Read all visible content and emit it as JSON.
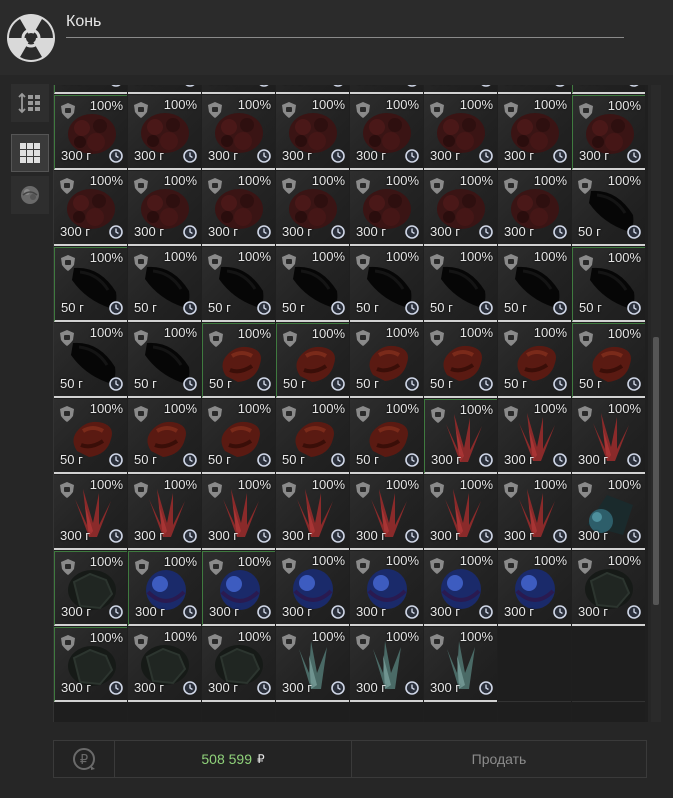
{
  "header": {
    "title": "Конь",
    "logo_icon": "radiation-icon"
  },
  "sidebar": {
    "buttons": [
      {
        "icon": "sort-icon"
      },
      {
        "icon": "grid-icon",
        "active": true
      },
      {
        "icon": "artifact-icon"
      }
    ]
  },
  "inventory": {
    "columns": 8,
    "partial_top_row_count": 8,
    "items": [
      {
        "type": "red-rock",
        "weight": "300 г",
        "durability": "100%",
        "green": true
      },
      {
        "type": "red-rock",
        "weight": "300 г",
        "durability": "100%",
        "green": false
      },
      {
        "type": "red-rock",
        "weight": "300 г",
        "durability": "100%",
        "green": false
      },
      {
        "type": "red-rock",
        "weight": "300 г",
        "durability": "100%",
        "green": false
      },
      {
        "type": "red-rock",
        "weight": "300 г",
        "durability": "100%",
        "green": false
      },
      {
        "type": "red-rock",
        "weight": "300 г",
        "durability": "100%",
        "green": false
      },
      {
        "type": "red-rock",
        "weight": "300 г",
        "durability": "100%",
        "green": false
      },
      {
        "type": "red-rock",
        "weight": "300 г",
        "durability": "100%",
        "green": true
      },
      {
        "type": "red-rock",
        "weight": "300 г",
        "durability": "100%",
        "green": false
      },
      {
        "type": "red-rock",
        "weight": "300 г",
        "durability": "100%",
        "green": false
      },
      {
        "type": "red-rock",
        "weight": "300 г",
        "durability": "100%",
        "green": false
      },
      {
        "type": "red-rock",
        "weight": "300 г",
        "durability": "100%",
        "green": false
      },
      {
        "type": "red-rock",
        "weight": "300 г",
        "durability": "100%",
        "green": false
      },
      {
        "type": "red-rock",
        "weight": "300 г",
        "durability": "100%",
        "green": false
      },
      {
        "type": "red-rock",
        "weight": "300 г",
        "durability": "100%",
        "green": false
      },
      {
        "type": "black-stone",
        "weight": "50 г",
        "durability": "100%",
        "green": false
      },
      {
        "type": "black-stone",
        "weight": "50 г",
        "durability": "100%",
        "green": true
      },
      {
        "type": "black-stone",
        "weight": "50 г",
        "durability": "100%",
        "green": false
      },
      {
        "type": "black-stone",
        "weight": "50 г",
        "durability": "100%",
        "green": false
      },
      {
        "type": "black-stone",
        "weight": "50 г",
        "durability": "100%",
        "green": false
      },
      {
        "type": "black-stone",
        "weight": "50 г",
        "durability": "100%",
        "green": false
      },
      {
        "type": "black-stone",
        "weight": "50 г",
        "durability": "100%",
        "green": false
      },
      {
        "type": "black-stone",
        "weight": "50 г",
        "durability": "100%",
        "green": false
      },
      {
        "type": "black-stone",
        "weight": "50 г",
        "durability": "100%",
        "green": true
      },
      {
        "type": "black-stone",
        "weight": "50 г",
        "durability": "100%",
        "green": false
      },
      {
        "type": "black-stone",
        "weight": "50 г",
        "durability": "100%",
        "green": false
      },
      {
        "type": "red-blob",
        "weight": "50 г",
        "durability": "100%",
        "green": true
      },
      {
        "type": "red-blob",
        "weight": "50 г",
        "durability": "100%",
        "green": true
      },
      {
        "type": "red-blob",
        "weight": "50 г",
        "durability": "100%",
        "green": false
      },
      {
        "type": "red-blob",
        "weight": "50 г",
        "durability": "100%",
        "green": false
      },
      {
        "type": "red-blob",
        "weight": "50 г",
        "durability": "100%",
        "green": false
      },
      {
        "type": "red-blob",
        "weight": "50 г",
        "durability": "100%",
        "green": true
      },
      {
        "type": "red-blob",
        "weight": "50 г",
        "durability": "100%",
        "green": false
      },
      {
        "type": "red-blob",
        "weight": "50 г",
        "durability": "100%",
        "green": false
      },
      {
        "type": "red-blob",
        "weight": "50 г",
        "durability": "100%",
        "green": false
      },
      {
        "type": "red-blob",
        "weight": "50 г",
        "durability": "100%",
        "green": false
      },
      {
        "type": "red-blob",
        "weight": "50 г",
        "durability": "100%",
        "green": false
      },
      {
        "type": "red-crystal",
        "weight": "300 г",
        "durability": "100%",
        "green": true
      },
      {
        "type": "red-crystal",
        "weight": "300 г",
        "durability": "100%",
        "green": false
      },
      {
        "type": "red-crystal",
        "weight": "300 г",
        "durability": "100%",
        "green": false
      },
      {
        "type": "red-crystal",
        "weight": "300 г",
        "durability": "100%",
        "green": false
      },
      {
        "type": "red-crystal",
        "weight": "300 г",
        "durability": "100%",
        "green": false
      },
      {
        "type": "red-crystal",
        "weight": "300 г",
        "durability": "100%",
        "green": false
      },
      {
        "type": "red-crystal",
        "weight": "300 г",
        "durability": "100%",
        "green": false
      },
      {
        "type": "red-crystal",
        "weight": "300 г",
        "durability": "100%",
        "green": false
      },
      {
        "type": "red-crystal",
        "weight": "300 г",
        "durability": "100%",
        "green": false
      },
      {
        "type": "red-crystal",
        "weight": "300 г",
        "durability": "100%",
        "green": false
      },
      {
        "type": "teal-crystal",
        "weight": "300 г",
        "durability": "100%",
        "green": false
      },
      {
        "type": "dark-cluster",
        "weight": "300 г",
        "durability": "100%",
        "green": true
      },
      {
        "type": "blue-sphere",
        "weight": "300 г",
        "durability": "100%",
        "green": true
      },
      {
        "type": "blue-sphere",
        "weight": "300 г",
        "durability": "100%",
        "green": true
      },
      {
        "type": "blue-sphere",
        "weight": "300 г",
        "durability": "100%",
        "green": false
      },
      {
        "type": "blue-sphere",
        "weight": "300 г",
        "durability": "100%",
        "green": false
      },
      {
        "type": "blue-sphere",
        "weight": "300 г",
        "durability": "100%",
        "green": false
      },
      {
        "type": "blue-sphere",
        "weight": "300 г",
        "durability": "100%",
        "green": false
      },
      {
        "type": "dark-cluster",
        "weight": "300 г",
        "durability": "100%",
        "green": false
      },
      {
        "type": "dark-cluster",
        "weight": "300 г",
        "durability": "100%",
        "green": true
      },
      {
        "type": "dark-cluster",
        "weight": "300 г",
        "durability": "100%",
        "green": false
      },
      {
        "type": "dark-cluster",
        "weight": "300 г",
        "durability": "100%",
        "green": false
      },
      {
        "type": "pale-crystal",
        "weight": "300 г",
        "durability": "100%",
        "green": false
      },
      {
        "type": "pale-crystal",
        "weight": "300 г",
        "durability": "100%",
        "green": false
      },
      {
        "type": "pale-crystal",
        "weight": "300 г",
        "durability": "100%",
        "green": false
      }
    ],
    "empty_slots": 2
  },
  "footer": {
    "money": "508 599",
    "currency": "₽",
    "sell_label": "Продать",
    "exchange_icon": "ruble-exchange-icon"
  },
  "colors": {
    "money": "#8fd27a",
    "highlight_border": "#3f7a3f"
  }
}
